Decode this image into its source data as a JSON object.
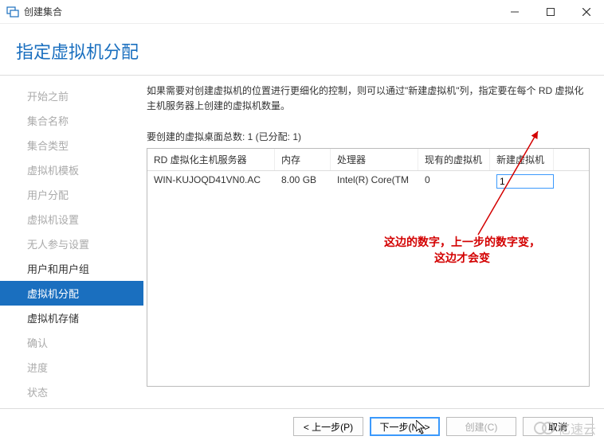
{
  "window": {
    "title": "创建集合"
  },
  "page": {
    "heading": "指定虚拟机分配"
  },
  "sidebar": {
    "items": [
      {
        "label": "开始之前",
        "state": "dim"
      },
      {
        "label": "集合名称",
        "state": "dim"
      },
      {
        "label": "集合类型",
        "state": "dim"
      },
      {
        "label": "虚拟机模板",
        "state": "dim"
      },
      {
        "label": "用户分配",
        "state": "dim"
      },
      {
        "label": "虚拟机设置",
        "state": "dim"
      },
      {
        "label": "无人参与设置",
        "state": "dim"
      },
      {
        "label": "用户和用户组",
        "state": "dark"
      },
      {
        "label": "虚拟机分配",
        "state": "active"
      },
      {
        "label": "虚拟机存储",
        "state": "dark"
      },
      {
        "label": "确认",
        "state": "dim"
      },
      {
        "label": "进度",
        "state": "dim"
      },
      {
        "label": "状态",
        "state": "dim"
      }
    ]
  },
  "main": {
    "description": "如果需要对创建虚拟机的位置进行更细化的控制，则可以通过\"新建虚拟机\"列，指定要在每个 RD 虚拟化主机服务器上创建的虚拟机数量。",
    "subheading": "要创建的虚拟桌面总数: 1 (已分配: 1)",
    "columns": {
      "host": "RD 虚拟化主机服务器",
      "memory": "内存",
      "cpu": "处理器",
      "existing": "现有的虚拟机",
      "newvm": "新建虚拟机"
    },
    "rows": [
      {
        "host": "WIN-KUJOQD41VN0.AC",
        "memory": "8.00 GB",
        "cpu": "Intel(R) Core(TM",
        "existing": "0",
        "newvm": "1"
      }
    ],
    "annotation": {
      "line1": "这边的数字，上一步的数字变，",
      "line2": "这边才会变"
    }
  },
  "footer": {
    "prev": "< 上一步(P)",
    "next": "下一步(N) >",
    "create": "创建(C)",
    "cancel": "取消"
  },
  "watermark": "亿速云"
}
